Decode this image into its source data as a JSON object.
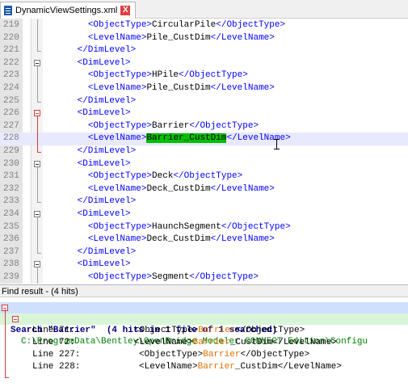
{
  "tab": {
    "filename": "DynamicViewSettings.xml",
    "close_label": "X"
  },
  "editor": {
    "lines": [
      {
        "num": "219",
        "indent": "        ",
        "open": "<ObjectType>",
        "text": "CircularPile",
        "close": "</ObjectType>"
      },
      {
        "num": "220",
        "indent": "        ",
        "open": "<LevelName>",
        "text": "Pile_CustDim",
        "close": "</LevelName>"
      },
      {
        "num": "221",
        "indent": "      ",
        "open": "",
        "text": "",
        "close": "</DimLevel>"
      },
      {
        "num": "222",
        "indent": "      ",
        "open": "<DimLevel>",
        "text": "",
        "close": ""
      },
      {
        "num": "223",
        "indent": "        ",
        "open": "<ObjectType>",
        "text": "HPile",
        "close": "</ObjectType>"
      },
      {
        "num": "224",
        "indent": "        ",
        "open": "<LevelName>",
        "text": "Pile_CustDim",
        "close": "</LevelName>"
      },
      {
        "num": "225",
        "indent": "      ",
        "open": "",
        "text": "",
        "close": "</DimLevel>"
      },
      {
        "num": "226",
        "indent": "      ",
        "open": "<DimLevel>",
        "text": "",
        "close": ""
      },
      {
        "num": "227",
        "indent": "        ",
        "open": "<ObjectType>",
        "text": "Barrier",
        "close": "</ObjectType>"
      },
      {
        "num": "228",
        "indent": "        ",
        "open": "<LevelName>",
        "text": "Barrier_CustDim",
        "close": "</LevelName>"
      },
      {
        "num": "229",
        "indent": "      ",
        "open": "",
        "text": "",
        "close": "</DimLevel>"
      },
      {
        "num": "230",
        "indent": "      ",
        "open": "<DimLevel>",
        "text": "",
        "close": ""
      },
      {
        "num": "231",
        "indent": "        ",
        "open": "<ObjectType>",
        "text": "Deck",
        "close": "</ObjectType>"
      },
      {
        "num": "232",
        "indent": "        ",
        "open": "<LevelName>",
        "text": "Deck_CustDim",
        "close": "</LevelName>"
      },
      {
        "num": "233",
        "indent": "      ",
        "open": "",
        "text": "",
        "close": "</DimLevel>"
      },
      {
        "num": "234",
        "indent": "      ",
        "open": "<DimLevel>",
        "text": "",
        "close": ""
      },
      {
        "num": "235",
        "indent": "        ",
        "open": "<ObjectType>",
        "text": "HaunchSegment",
        "close": "</ObjectType>"
      },
      {
        "num": "236",
        "indent": "        ",
        "open": "<LevelName>",
        "text": "Deck_CustDim",
        "close": "</LevelName>"
      },
      {
        "num": "237",
        "indent": "      ",
        "open": "",
        "text": "",
        "close": "</DimLevel>"
      },
      {
        "num": "238",
        "indent": "      ",
        "open": "<DimLevel>",
        "text": "",
        "close": ""
      },
      {
        "num": "239",
        "indent": "        ",
        "open": "<ObjectType>",
        "text": "Segment",
        "close": "</ObjectType>"
      }
    ],
    "current_line": "228",
    "selected_text": "Barrier_CustDim"
  },
  "find": {
    "header": "Find result - (4 hits)",
    "search_line": "Search \"Barrier\"  (4 hits in 1 file of 1 searched)",
    "file_line": "C:\\ProgramData\\Bentley\\OpenBridge Modeler CONNECT Edition\\Configu",
    "hits": [
      {
        "label": "Line 71:",
        "pad": "        ",
        "pre": "<ObjectType>",
        "hit": "Barrier",
        "post": "</ObjectType>"
      },
      {
        "label": "Line 72:",
        "pad": "        ",
        "pre": "<LevelName>",
        "hit": "Barrier",
        "post": "_CustDim</LevelName>"
      },
      {
        "label": "Line 227:",
        "pad": "        ",
        "pre": "<ObjectType>",
        "hit": "Barrier",
        "post": "</ObjectType>"
      },
      {
        "label": "Line 228:",
        "pad": "        ",
        "pre": "<LevelName>",
        "hit": "Barrier",
        "post": "_CustDim</LevelName>"
      }
    ]
  }
}
